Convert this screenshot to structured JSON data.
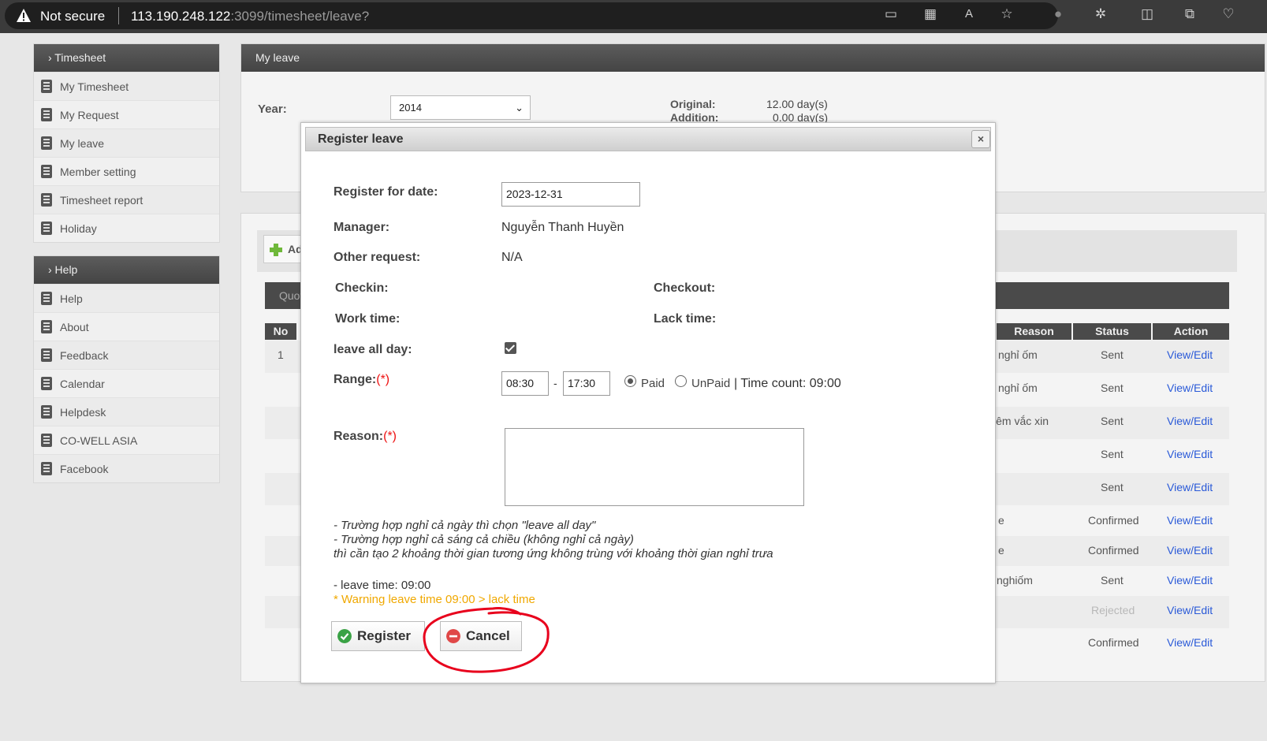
{
  "browser": {
    "security": "Not secure",
    "url_host": "113.190.248.122",
    "url_rest": ":3099/timesheet/leave?"
  },
  "sidebar": {
    "timesheet_header": "› Timesheet",
    "timesheet_items": [
      "My Timesheet",
      "My Request",
      "My leave",
      "Member setting",
      "Timesheet report",
      "Holiday"
    ],
    "help_header": "› Help",
    "help_items": [
      "Help",
      "About",
      "Feedback",
      "Calendar",
      "Helpdesk",
      "CO-WELL ASIA",
      "Facebook"
    ]
  },
  "main": {
    "title": "My leave",
    "year_label": "Year:",
    "year_value": "2014",
    "original_label": "Original:",
    "original_value": "12.00 day(s)",
    "addition_label": "Addition:",
    "addition_value": "0.00 day(s)",
    "add_label": "Ad",
    "quota_label": "Quot",
    "table": {
      "headers": {
        "no": "No",
        "reason": "Reason",
        "status": "Status",
        "action": "Action"
      },
      "first_no": "1",
      "rows": [
        {
          "reason": "nghỉ ốm",
          "status": "Sent",
          "action": "View/Edit"
        },
        {
          "reason": "nghỉ ốm",
          "status": "Sent",
          "action": "View/Edit"
        },
        {
          "reason": "iêm vắc xin",
          "status": "Sent",
          "action": "View/Edit"
        },
        {
          "reason": "",
          "status": "Sent",
          "action": "View/Edit"
        },
        {
          "reason": "",
          "status": "Sent",
          "action": "View/Edit"
        },
        {
          "reason": "e",
          "status": "Confirmed",
          "action": "View/Edit"
        },
        {
          "reason": "e",
          "status": "Confirmed",
          "action": "View/Edit"
        },
        {
          "reason": "nghiốm",
          "status": "Sent",
          "action": "View/Edit"
        },
        {
          "reason": "",
          "status": "Rejected",
          "action": "View/Edit"
        },
        {
          "reason": "",
          "status": "Confirmed",
          "action": "View/Edit"
        }
      ]
    }
  },
  "modal": {
    "title": "Register leave",
    "close_label": "×",
    "register_date_label": "Register for date:",
    "register_date_value": "2023-12-31",
    "manager_label": "Manager:",
    "manager_value": "Nguyễn Thanh Huyền",
    "other_request_label": "Other request:",
    "other_request_value": "N/A",
    "checkin_label": "Checkin:",
    "checkout_label": "Checkout:",
    "work_time_label": "Work time:",
    "lack_time_label": "Lack time:",
    "leave_all_day_label": "leave all day:",
    "leave_all_day_checked": true,
    "range_label": "Range:",
    "required_mark": "(*)",
    "range_start": "08:30",
    "range_sep": "-",
    "range_end": "17:30",
    "paid_label": "Paid",
    "unpaid_label": "UnPaid",
    "time_count": "| Time count: 09:00",
    "reason_label": "Reason:",
    "notes": [
      "- Trường hợp nghỉ cả ngày thì chọn \"leave all day\"",
      "- Trường hợp nghỉ cả sáng cả chiều (không nghỉ cả ngày)",
      "thì cần tạo 2 khoảng thời gian tương ứng không trùng với khoảng thời gian nghỉ trưa"
    ],
    "leave_time": "- leave time: 09:00",
    "warning": "* Warning leave time 09:00 > lack time",
    "register_button": "Register",
    "cancel_button": "Cancel"
  },
  "colors": {
    "header_dark": "#4a4a4a",
    "link": "#2a5ad8",
    "warning": "#f0a800",
    "required": "#e11111",
    "annotation": "#e8001c"
  }
}
